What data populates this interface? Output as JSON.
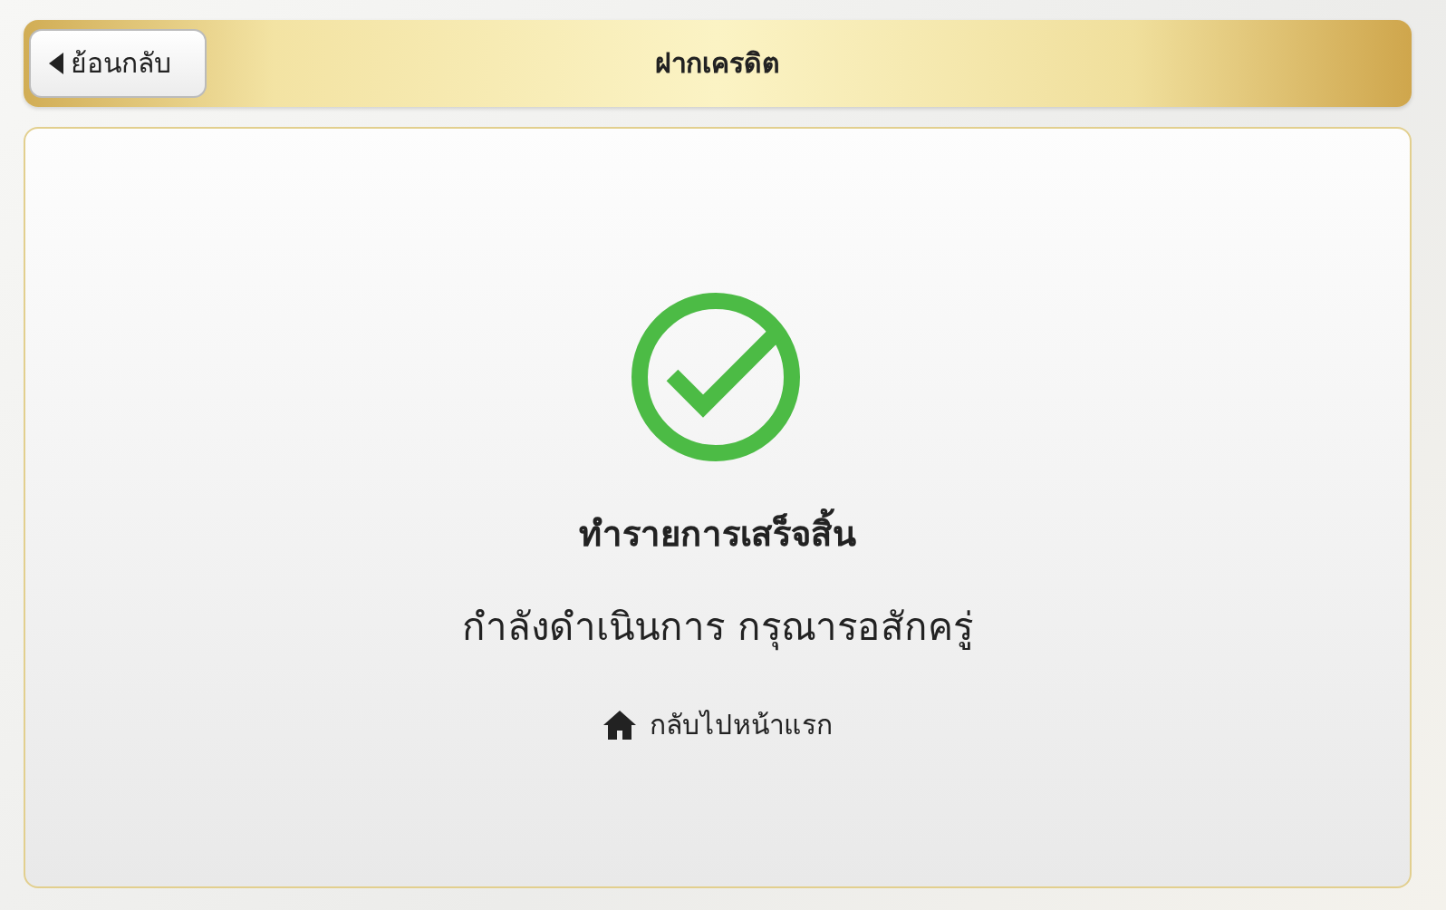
{
  "header": {
    "back_button": "ย้อนกลับ",
    "title": "ฝากเครดิต"
  },
  "result": {
    "kind": "success",
    "title": "ทำรายการเสร็จสิ้น",
    "message": "กำลังดำเนินการ กรุณารอสักครู่",
    "home_link": "กลับไปหน้าแรก"
  }
}
